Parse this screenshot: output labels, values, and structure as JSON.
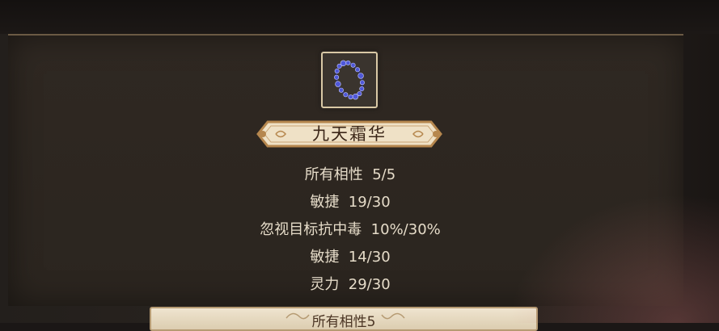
{
  "item": {
    "name": "九天霜华",
    "icon": "blue-bead-bracelet-icon",
    "colors": {
      "title_plate": "#efe1c6",
      "title_border": "#b6874e",
      "stat_text": "#e6dcc9",
      "bead": "#4f58d8"
    }
  },
  "stats": [
    {
      "name": "所有相性",
      "value": "5/5"
    },
    {
      "name": "敏捷",
      "value": "19/30"
    },
    {
      "name": "忽视目标抗中毒",
      "value": "10%/30%"
    },
    {
      "name": "敏捷",
      "value": "14/30"
    },
    {
      "name": "灵力",
      "value": "29/30"
    }
  ],
  "next_panel": {
    "label": "所有相性5"
  }
}
